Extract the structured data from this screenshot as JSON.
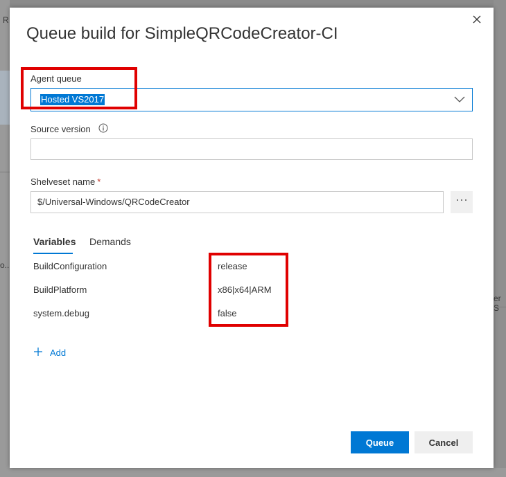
{
  "dialog": {
    "title": "Queue build for SimpleQRCodeCreator-CI"
  },
  "agent_queue": {
    "label": "Agent queue",
    "value": "Hosted VS2017"
  },
  "source_version": {
    "label": "Source version",
    "value": ""
  },
  "shelveset": {
    "label": "Shelveset name",
    "required_mark": "*",
    "value": "$/Universal-Windows/QRCodeCreator",
    "browse_label": "···"
  },
  "tabs": [
    {
      "label": "Variables",
      "active": true
    },
    {
      "label": "Demands",
      "active": false
    }
  ],
  "variables": [
    {
      "name": "BuildConfiguration",
      "value": "release"
    },
    {
      "name": "BuildPlatform",
      "value": "x86|x64|ARM"
    },
    {
      "name": "system.debug",
      "value": "false"
    }
  ],
  "add_label": "Add",
  "buttons": {
    "queue": "Queue",
    "cancel": "Cancel"
  },
  "background": {
    "left_fragment": "o...",
    "right_fragment": "er S",
    "top_left_fragment": "R"
  },
  "colors": {
    "accent": "#0078d4",
    "annotation": "#e00000"
  }
}
